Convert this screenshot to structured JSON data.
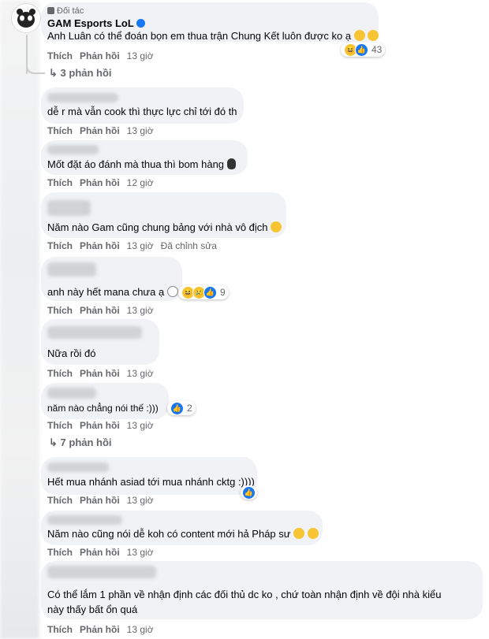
{
  "c1": {
    "badge": "Đối tác",
    "name": "GAM Esports LoL",
    "text": "Anh Luân có thể đoán bọn em thua trận Chung Kết luôn được ko ạ",
    "like": "Thích",
    "reply": "Phản hồi",
    "time": "13 giờ",
    "reactions": "43",
    "replies_link": "3 phản hồi"
  },
  "c2": {
    "text": "dễ r mà vẫn cook thì thực lực chỉ tới đó th",
    "like": "Thích",
    "reply": "Phản hồi",
    "time": "13 giờ"
  },
  "c3": {
    "text": "Mốt đặt áo đánh mà thua thì bom hàng",
    "like": "Thích",
    "reply": "Phản hồi",
    "time": "12 giờ"
  },
  "c4": {
    "text": "Năm nào Gam cũng chung bảng với nhà vô địch",
    "like": "Thích",
    "reply": "Phản hồi",
    "time": "13 giờ",
    "edited": "Đã chỉnh sửa"
  },
  "c5": {
    "text": "anh này hết mana chưa ạ",
    "like": "Thích",
    "reply": "Phản hồi",
    "time": "13 giờ",
    "reactions": "9"
  },
  "c6": {
    "text": "Nữa rồi đó",
    "like": "Thích",
    "reply": "Phản hồi",
    "time": "13 giờ"
  },
  "c7": {
    "text": "năm nào chẳng nói thế :)))",
    "like": "Thích",
    "reply": "Phản hồi",
    "time": "13 giờ",
    "reactions": "2",
    "replies_link": "7 phản hồi"
  },
  "c8": {
    "text": "Hết mua nhánh asiad tới mua nhánh cktg :))))",
    "like": "Thích",
    "reply": "Phản hồi",
    "time": "13 giờ"
  },
  "c9": {
    "text": "Năm nào cũng nói dễ koh có content mới hả Pháp sư",
    "like": "Thích",
    "reply": "Phản hồi",
    "time": "13 giờ"
  },
  "c10": {
    "text_line1": "Có thể lắm 1 phần về nhận định các đối thủ dc ko , chứ toàn nhận định về đội nhà kiểu",
    "text_line2": "này thấy bất ổn quá",
    "like": "Thích",
    "reply": "Phản hồi",
    "time": "13 giờ"
  },
  "colors": {
    "bubble": "#f0f2f5",
    "meta": "#65676b",
    "like_blue": "#1877f2"
  }
}
